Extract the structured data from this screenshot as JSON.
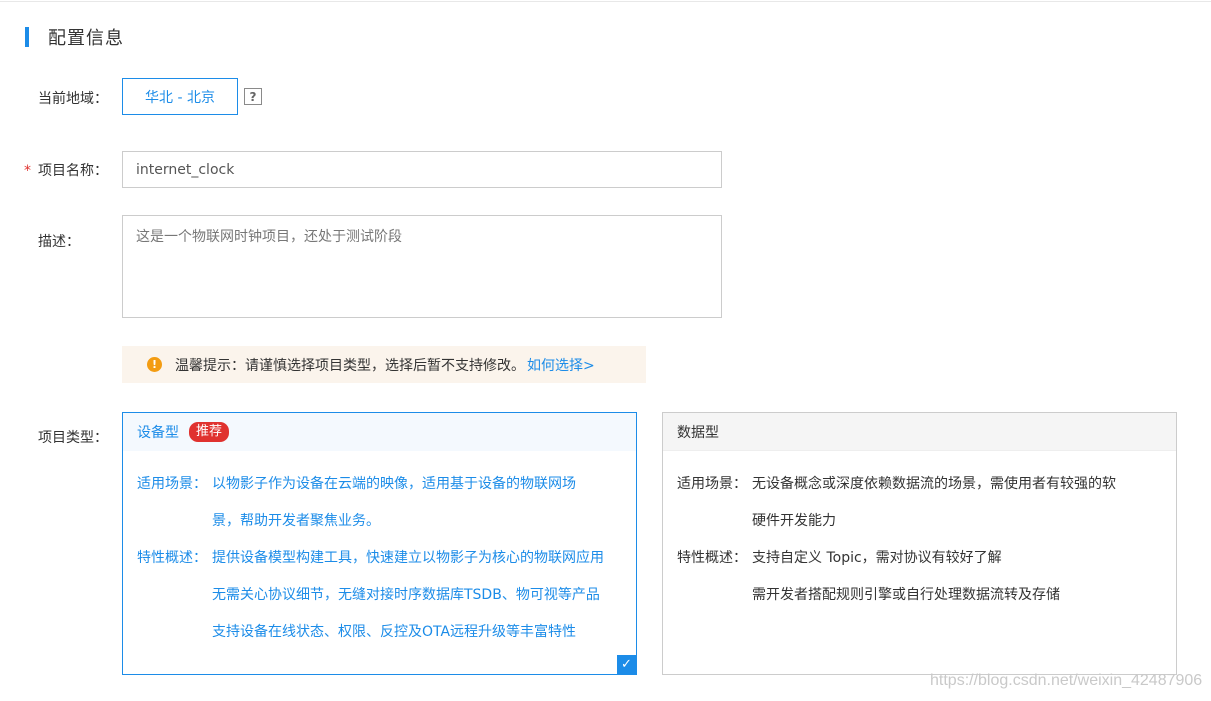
{
  "section": {
    "title": "配置信息"
  },
  "region": {
    "label": "当前地域：",
    "value": "华北 - 北京",
    "help_icon": "?"
  },
  "project_name": {
    "required_mark": "*",
    "label": "项目名称：",
    "value": "internet_clock"
  },
  "description": {
    "label": "描述：",
    "value": "这是一个物联网时钟项目，还处于测试阶段"
  },
  "tip": {
    "icon": "!",
    "text": "温馨提示：请谨慎选择项目类型，选择后暂不支持修改。",
    "link": "如何选择>"
  },
  "project_type": {
    "label": "项目类型：",
    "device_card": {
      "title": "设备型",
      "badge": "推荐",
      "scene_label": "适用场景：",
      "scene_line1": "以物影子作为设备在云端的映像，适用基于设备的物联网场",
      "scene_line2": "景，帮助开发者聚焦业务。",
      "feature_label": "特性概述：",
      "feature_line1": "提供设备模型构建工具，快速建立以物影子为核心的物联网应用",
      "feature_line2": "无需关心协议细节，无缝对接时序数据库TSDB、物可视等产品",
      "feature_line3": "支持设备在线状态、权限、反控及OTA远程升级等丰富特性",
      "check": "✓"
    },
    "data_card": {
      "title": "数据型",
      "scene_label": "适用场景：",
      "scene_line1": "无设备概念或深度依赖数据流的场景，需使用者有较强的软",
      "scene_line2": "硬件开发能力",
      "feature_label": "特性概述：",
      "feature_line1": "支持自定义 Topic，需对协议有较好了解",
      "feature_line2": "需开发者搭配规则引擎或自行处理数据流转及存储"
    }
  },
  "watermark": "https://blog.csdn.net/weixin_42487906",
  "colors": {
    "accent": "#1c8ce8",
    "required": "#e0322f",
    "warning": "#f39c12",
    "tip_bg": "#fbf4ec"
  }
}
